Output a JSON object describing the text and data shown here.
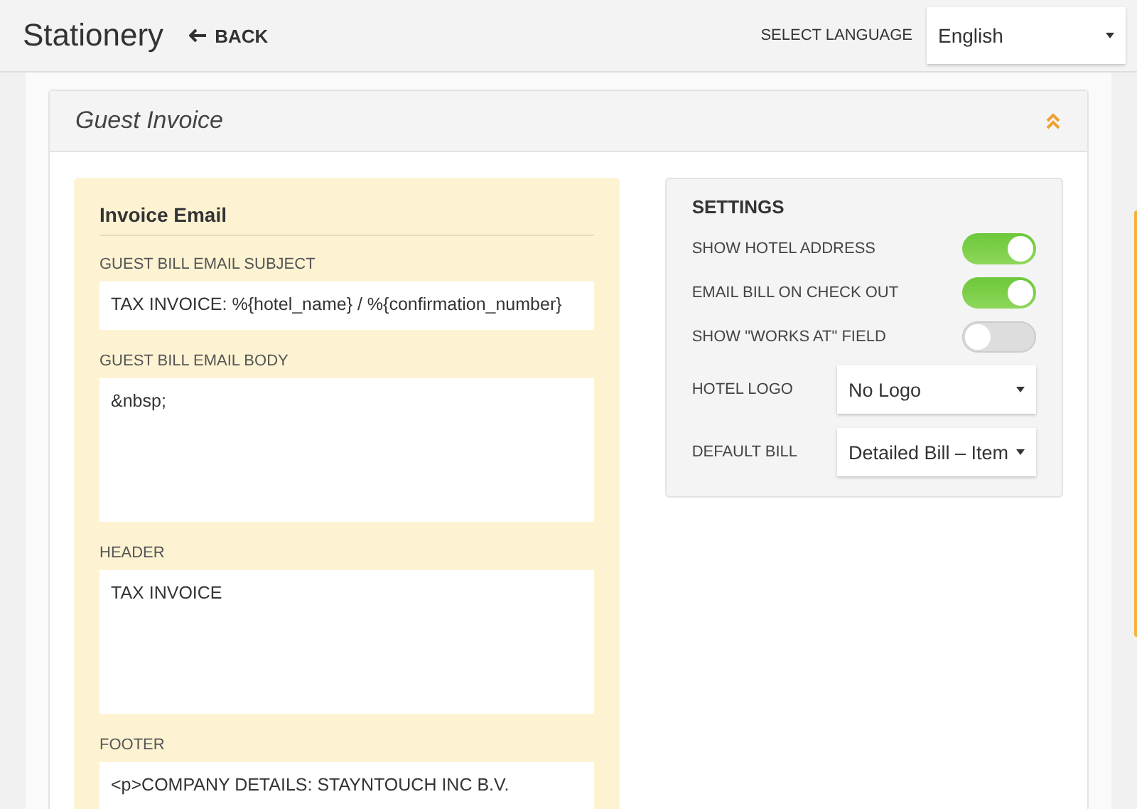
{
  "header": {
    "title": "Stationery",
    "back": "BACK",
    "language_label": "SELECT LANGUAGE",
    "language": "English"
  },
  "section": {
    "title": "Guest Invoice",
    "expanded": true
  },
  "invoice_email": {
    "title": "Invoice Email",
    "fields": [
      {
        "label": "GUEST BILL EMAIL SUBJECT",
        "kind": "input",
        "value": "TAX INVOICE: %{hotel_name} / %{confirmation_number}"
      },
      {
        "label": "GUEST BILL EMAIL BODY",
        "kind": "textarea",
        "value": "&nbsp;"
      },
      {
        "label": "HEADER",
        "kind": "textarea",
        "value": "TAX INVOICE"
      },
      {
        "label": "FOOTER",
        "kind": "textarea",
        "value": "<p>COMPANY DETAILS: STAYNTOUCH INC B.V."
      }
    ]
  },
  "settings": {
    "title": "SETTINGS",
    "items": [
      {
        "label": "SHOW HOTEL ADDRESS",
        "kind": "toggle",
        "on": true
      },
      {
        "label": "EMAIL BILL ON CHECK OUT",
        "kind": "toggle",
        "on": true
      },
      {
        "label": "SHOW \"WORKS AT\" FIELD",
        "kind": "toggle",
        "on": false
      },
      {
        "label": "HOTEL LOGO",
        "kind": "select",
        "value": "No Logo"
      },
      {
        "label": "DEFAULT BILL",
        "kind": "select",
        "value": "Detailed Bill – Item"
      }
    ]
  }
}
